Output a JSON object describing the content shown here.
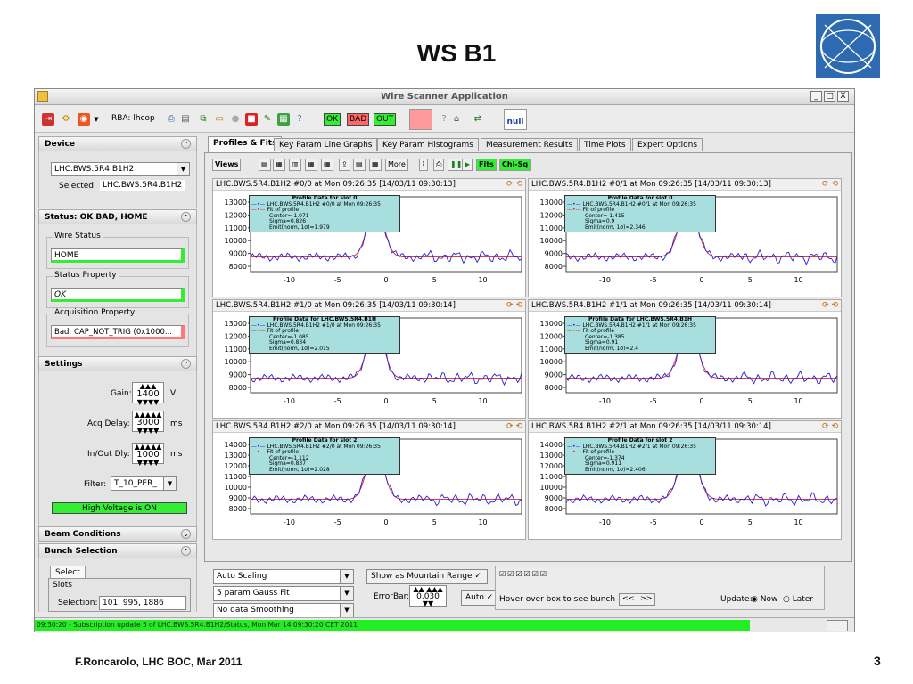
{
  "slide": {
    "title": "WS B1",
    "footer": "F.Roncarolo, LHC BOC, Mar 2011",
    "page_number": "3",
    "logo_text": "CERN"
  },
  "app": {
    "title": "Wire Scanner Application",
    "window_buttons": [
      "_",
      "□",
      "X"
    ],
    "toolbar": {
      "rba_label": "RBA: lhcop",
      "status": [
        "OK",
        "BAD",
        "OUT"
      ],
      "null_label": "null"
    },
    "left": {
      "device": {
        "header": "Device",
        "selected_combo": "LHC.BWS.5R4.B1H2",
        "selected_label": "Selected:",
        "selected_value": "LHC.BWS.5R4.B1H2"
      },
      "status": {
        "header": "Status: OK BAD, HOME",
        "wire_status_label": "Wire Status",
        "wire_status": "HOME",
        "status_property_label": "Status Property",
        "status_property": "OK",
        "acq_property_label": "Acquisition Property",
        "acq_property": "Bad: CAP_NOT_TRIG (0x1000..."
      },
      "settings": {
        "header": "Settings",
        "gain_label": "Gain:",
        "gain_value": "1400",
        "gain_unit": "V",
        "acq_delay_label": "Acq Delay:",
        "acq_delay_value": "3000",
        "acq_delay_unit": "ms",
        "inout_label": "In/Out Dly:",
        "inout_value": "1000",
        "inout_unit": "ms",
        "filter_label": "Filter:",
        "filter_value": "T_10_PER_...",
        "hv_text": "High Voltage is ON"
      },
      "beam_conditions": "Beam Conditions",
      "bunch": {
        "header": "Bunch Selection",
        "tab": "Select",
        "slots_label": "Slots",
        "selection_label": "Selection:",
        "selection_value": "101, 995, 1886"
      }
    },
    "tabs": [
      "Profiles & Fits",
      "Key Param Line Graphs",
      "Key Param Histograms",
      "Measurement Results",
      "Time Plots",
      "Expert Options"
    ],
    "plot_toolbar": {
      "views": "Views",
      "more": "More",
      "fits": "Fits",
      "chisq": "Chi-Sq"
    },
    "panels": [
      {
        "title": "LHC.BWS.5R4.B1H2 #0/0 at Mon 09:26:35 [14/03/11 09:30:13]",
        "legend_header": "Profile Data for slot 0",
        "legend_series": "LHC.BWS.5R4.B1H2 #0/0 at Mon 09:26:35",
        "legend_fit": "Fit of profile",
        "center": "Center=-1.071",
        "sigma": "Sigma=0.826",
        "emit": "Emit(norm, 1σ)=1.979",
        "yticks": [
          "13000",
          "12000",
          "11000",
          "10000",
          "9000",
          "8000"
        ]
      },
      {
        "title": "LHC.BWS.5R4.B1H2 #0/1 at Mon 09:26:35 [14/03/11 09:30:13]",
        "legend_header": "Profile Data for slot 0",
        "legend_series": "LHC.BWS.5R4.B1H2 #0/1 at Mon 09:26:35",
        "legend_fit": "Fit of profile",
        "center": "Center=-1.415",
        "sigma": "Sigma=0.9",
        "emit": "Emit(norm, 1σ)=2.346",
        "yticks": [
          "13000",
          "12000",
          "11000",
          "10000",
          "9000",
          "8000"
        ]
      },
      {
        "title": "LHC.BWS.5R4.B1H2 #1/0 at Mon 09:26:35 [14/03/11 09:30:14]",
        "legend_header": "Profile Data for LHC.BWS.5R4.B1H",
        "legend_series": "LHC.BWS.5R4.B1H2 #1/0 at Mon 09:26:35",
        "legend_fit": "Fit of profile",
        "center": "Center=-1.085",
        "sigma": "Sigma=0.834",
        "emit": "Emit(norm, 1σ)=2.015",
        "yticks": [
          "13000",
          "12000",
          "11000",
          "10000",
          "9000",
          "8000"
        ]
      },
      {
        "title": "LHC.BWS.5R4.B1H2 #1/1 at Mon 09:26:35 [14/03/11 09:30:14]",
        "legend_header": "Profile Data for LHC.BWS.5R4.B1H",
        "legend_series": "LHC.BWS.5R4.B1H2 #1/1 at Mon 09:26:35",
        "legend_fit": "Fit of profile",
        "center": "Center=-1.385",
        "sigma": "Sigma=0.91",
        "emit": "Emit(norm, 1σ)=2.4",
        "yticks": [
          "13000",
          "12000",
          "11000",
          "10000",
          "9000",
          "8000"
        ]
      },
      {
        "title": "LHC.BWS.5R4.B1H2 #2/0 at Mon 09:26:35 [14/03/11 09:30:14]",
        "legend_header": "Profile Data for slot 2",
        "legend_series": "LHC.BWS.5R4.B1H2 #2/0 at Mon 09:26:35",
        "legend_fit": "Fit of profile",
        "center": "Center=-1.112",
        "sigma": "Sigma=0.837",
        "emit": "Emit(norm, 1σ)=2.028",
        "yticks": [
          "14000",
          "13000",
          "12000",
          "11000",
          "10000",
          "9000",
          "8000"
        ]
      },
      {
        "title": "LHC.BWS.5R4.B1H2 #2/1 at Mon 09:26:35 [14/03/11 09:30:14]",
        "legend_header": "Profile Data for slot 2",
        "legend_series": "LHC.BWS.5R4.B1H2 #2/1 at Mon 09:26:35",
        "legend_fit": "Fit of profile",
        "center": "Center=-1.374",
        "sigma": "Sigma=0.911",
        "emit": "Emit(norm, 1σ)=2.406",
        "yticks": [
          "14000",
          "13000",
          "12000",
          "11000",
          "10000",
          "9000",
          "8000"
        ]
      }
    ],
    "xticks": [
      "-10",
      "-5",
      "0",
      "5",
      "10"
    ],
    "bottom": {
      "scaling": "Auto Scaling",
      "fit": "5 param Gauss Fit",
      "smoothing": "No data Smoothing",
      "mountain": "Show as Mountain Range",
      "errorbar_label": "ErrorBar:",
      "errorbar_value": "0.030",
      "auto": "Auto",
      "hover": "Hover over box to see bunch #",
      "prev": "<<",
      "next": ">>",
      "update_label": "Update:",
      "update_now": "Now",
      "update_later": "Later"
    },
    "status_message": "09:30:20 - Subscription update 5 of LHC.BWS.5R4.B1H2/Status, Mon Mar 14 09:30:20 CET 2011",
    "colors": {
      "ok": "#33ee33",
      "bad": "#ff6666",
      "legend_bg": "#a8dede",
      "data": "#2222dd",
      "fit": "#dd2222",
      "status_bar": "#22ee22"
    }
  }
}
